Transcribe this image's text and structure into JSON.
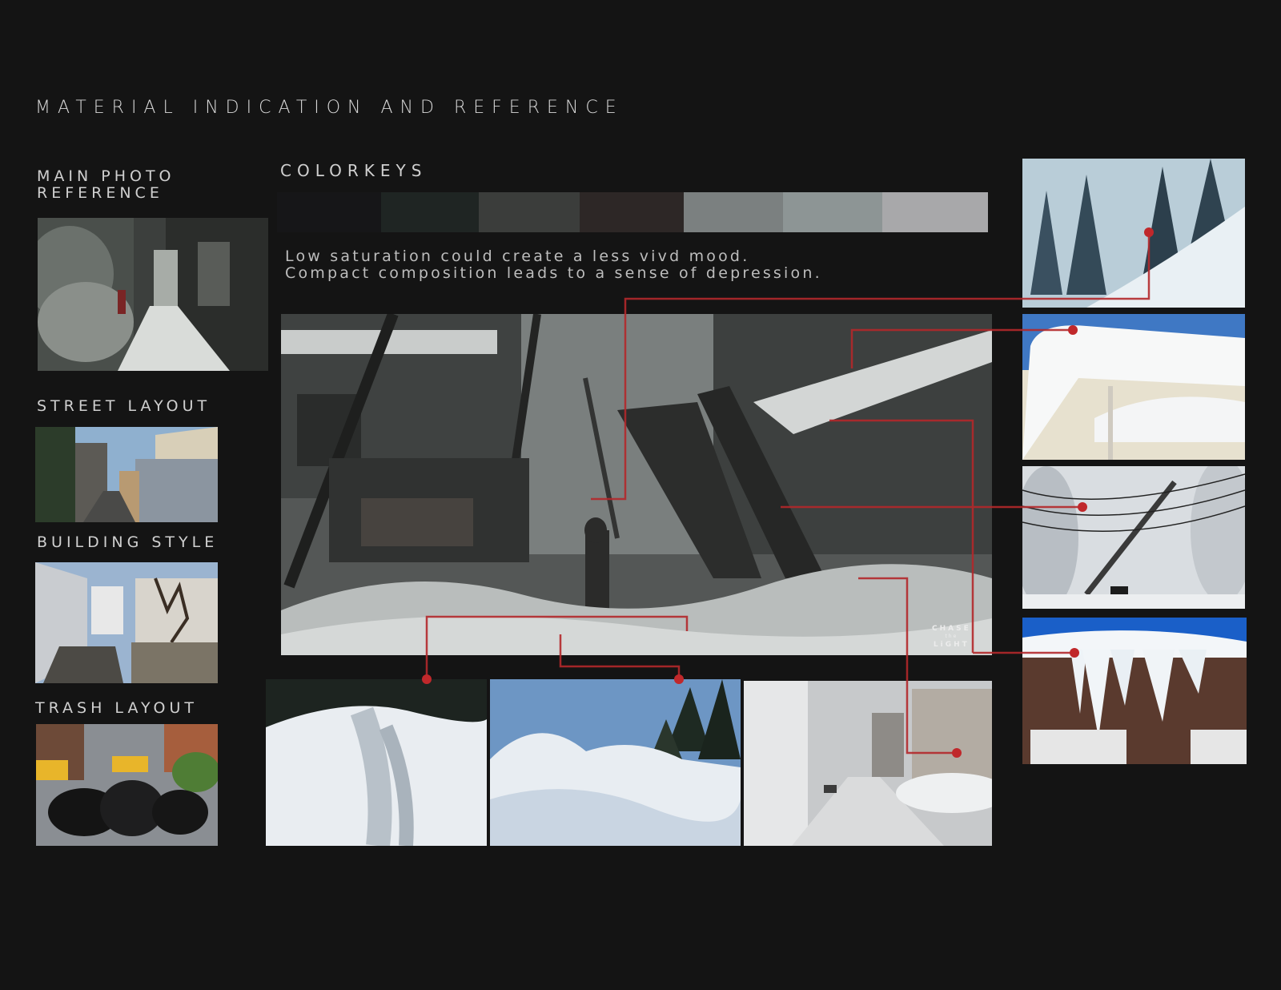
{
  "title": "MATERIAL INDICATION AND REFERENCE",
  "sections": {
    "main_photo_line1": "MAIN PHOTO",
    "main_photo_line2": "REFERENCE",
    "street_layout": "STREET LAYOUT",
    "building_style": "BUILDING STYLE",
    "trash_layout": "TRASH LAYOUT",
    "colorkeys": "COLORKEYS"
  },
  "description": {
    "line1": "Low saturation could create a less vivd mood.",
    "line2": "Compact composition leads to a sense of depression."
  },
  "colorkeys": [
    "#161618",
    "#1f2523",
    "#3b3d3b",
    "#2d2726",
    "#7b8080",
    "#8d9595",
    "#a8a8aa"
  ],
  "logo": {
    "line1": "CHASE",
    "line2": "the",
    "line3": "LiGHT"
  },
  "colors": {
    "background": "#141414",
    "accent_red": "#b3282b"
  },
  "icons": [
    "marker-dot-icon"
  ]
}
